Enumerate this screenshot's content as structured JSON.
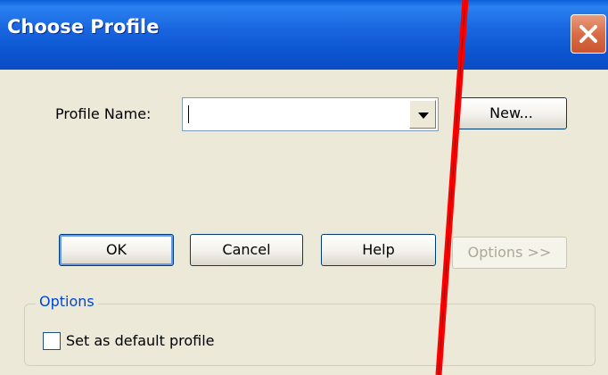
{
  "window": {
    "title": "Choose Profile",
    "close_icon": "close-icon"
  },
  "profile": {
    "label": "Profile Name:",
    "value": "",
    "dropdown_icon": "chevron-down-icon"
  },
  "buttons": {
    "new": "New...",
    "ok": "OK",
    "cancel": "Cancel",
    "help": "Help",
    "options": "Options >>"
  },
  "options_group": {
    "legend": "Options",
    "checkbox_label": "Set as default profile",
    "checked": false
  },
  "colors": {
    "title_bar": "#0a55d0",
    "close_button": "#d96d46",
    "dialog_bg": "#ece9d8",
    "group_legend": "#0046d5",
    "annotation_line": "#ff0000"
  }
}
